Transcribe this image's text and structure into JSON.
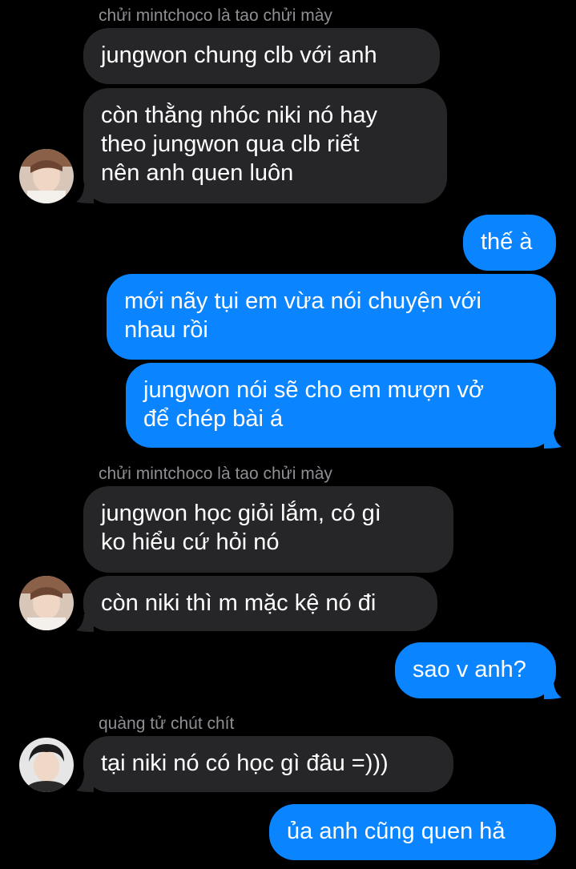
{
  "thread": {
    "messages": [
      {
        "id": "m1",
        "direction": "incoming",
        "sender": "chửi mintchoco là tao chửi mày",
        "text": "jungwon chung clb với anh"
      },
      {
        "id": "m2",
        "direction": "incoming",
        "text": "còn thằng nhóc niki nó hay\ntheo jungwon qua clb riết\nnên anh quen luôn"
      },
      {
        "id": "m3",
        "direction": "outgoing",
        "text": "thế à"
      },
      {
        "id": "m4",
        "direction": "outgoing",
        "text": "mới nãy tụi em vừa nói chuyện với\nnhau rồi"
      },
      {
        "id": "m5",
        "direction": "outgoing",
        "text": "jungwon nói sẽ cho em mượn vở\nđể chép bài á"
      },
      {
        "id": "m6",
        "direction": "incoming",
        "sender": "chửi mintchoco là tao chửi mày",
        "text": "jungwon học giỏi lắm, có gì\nko hiểu cứ hỏi nó"
      },
      {
        "id": "m7",
        "direction": "incoming",
        "text": "còn niki thì m mặc kệ nó đi"
      },
      {
        "id": "m8",
        "direction": "outgoing",
        "text": "sao v anh?"
      },
      {
        "id": "m9",
        "direction": "incoming",
        "sender": "quàng tử chút chít",
        "text": "tại niki nó có học gì đâu =)))"
      },
      {
        "id": "m10",
        "direction": "outgoing",
        "text": "ủa anh cũng quen hả"
      }
    ]
  },
  "colors": {
    "background": "#000000",
    "incoming_bubble": "#262629",
    "outgoing_bubble": "#0a84ff",
    "sender_label": "#8e8e93",
    "text": "#ffffff"
  },
  "icons": {
    "avatar_1": "user-avatar-photo",
    "avatar_2": "user-avatar-photo"
  }
}
